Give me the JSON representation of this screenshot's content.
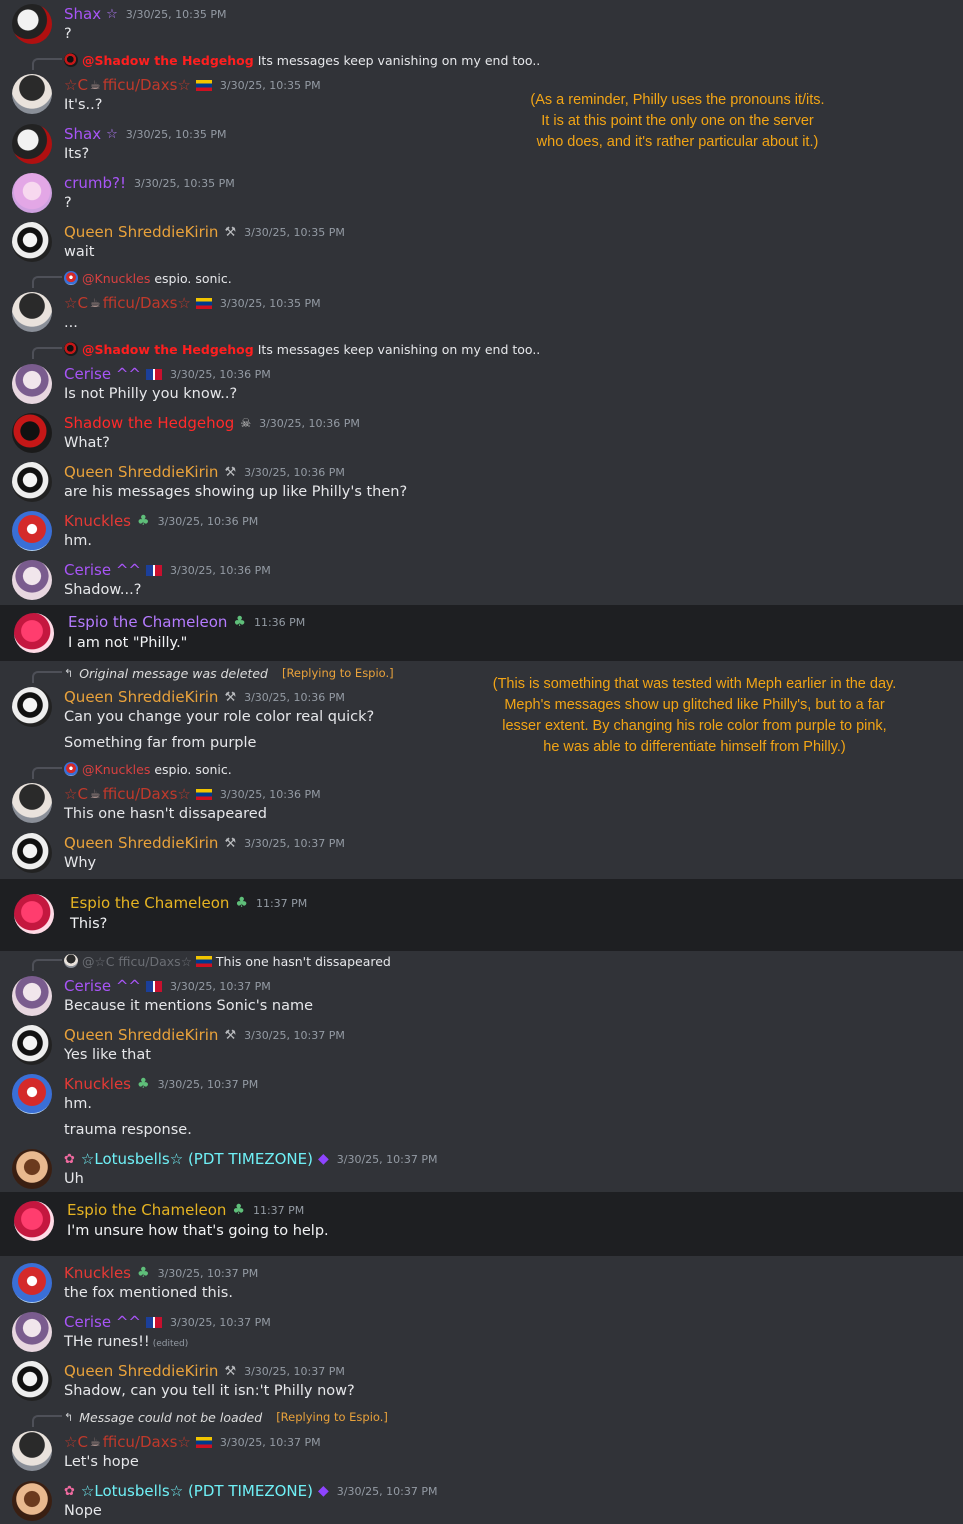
{
  "notes": {
    "pronouns": [
      "(As a reminder, Philly uses the pronouns it/its.",
      "It is at this point the only one on the server",
      "who does, and it's rather particular about it.)"
    ],
    "meph": [
      "(This is something that was tested with Meph earlier in the day.",
      "Meph's messages show up glitched like Philly's, but to a far",
      "lesser extent. By changing his role color from purple to pink,",
      "he was able to differentiate himself from Philly.)"
    ]
  },
  "names": {
    "shax": "Shax",
    "cofficu_pre": "☆C",
    "cofficu_post": "fficu/Daxs☆",
    "crumb": "crumb?!",
    "queen": "Queen ShreddieKirin",
    "cerise": "Cerise ^^",
    "shadow": "Shadow the Hedgehog",
    "knuckles": "Knuckles",
    "espio": "Espio the Chameleon",
    "lotus": "☆Lotusbells☆ (PDT TIMEZONE)"
  },
  "replies": {
    "r1_mention": "@Shadow the Hedgehog",
    "r1_text": "Its messages keep vanishing on my end too..",
    "r2_mention": "@Knuckles",
    "r2_text": "espio. sonic.",
    "r3_mention": "@Shadow the Hedgehog",
    "r3_text": "Its messages keep vanishing on my end too..",
    "r4_text": "Original message was deleted",
    "r4_tag": "[Replying to Espio.]",
    "r5_mention": "@Knuckles",
    "r5_text": "espio. sonic.",
    "r6_mention": "@☆C fficu/Daxs☆",
    "r6_text": "This one hasn't dissapeared",
    "r7_text": "Message could not be loaded",
    "r7_tag": "[Replying to Espio.]"
  },
  "messages": [
    {
      "time": "3/30/25, 10:35 PM",
      "text": "?"
    },
    {
      "time": "3/30/25, 10:35 PM",
      "text": "It's..?"
    },
    {
      "time": "3/30/25, 10:35 PM",
      "text": "Its?"
    },
    {
      "time": "3/30/25, 10:35 PM",
      "text": "?"
    },
    {
      "time": "3/30/25, 10:35 PM",
      "text": "wait"
    },
    {
      "time": "3/30/25, 10:35 PM",
      "text": "..."
    },
    {
      "time": "3/30/25, 10:36 PM",
      "text": "Is not Philly you know..?"
    },
    {
      "time": "3/30/25, 10:36 PM",
      "text": "What?"
    },
    {
      "time": "3/30/25, 10:36 PM",
      "text": "are his messages showing up like Philly's then?"
    },
    {
      "time": "3/30/25, 10:36 PM",
      "text": "hm."
    },
    {
      "time": "3/30/25, 10:36 PM",
      "text": "Shadow...?"
    },
    {
      "time": "11:36 PM",
      "text": "I am not \"Philly.\""
    },
    {
      "time": "3/30/25, 10:36 PM",
      "text": "Can you change your role color real quick?",
      "text2": "Something far from purple"
    },
    {
      "time": "3/30/25, 10:36 PM",
      "text": "This one hasn't dissapeared"
    },
    {
      "time": "3/30/25, 10:37 PM",
      "text": "Why"
    },
    {
      "time": "11:37 PM",
      "text": "This?"
    },
    {
      "time": "3/30/25, 10:37 PM",
      "text": "Because it mentions Sonic's name"
    },
    {
      "time": "3/30/25, 10:37 PM",
      "text": "Yes like that"
    },
    {
      "time": "3/30/25, 10:37 PM",
      "text": "hm.",
      "text2": "trauma response."
    },
    {
      "time": "3/30/25, 10:37 PM",
      "text": "Uh"
    },
    {
      "time": "11:37 PM",
      "text": "I'm unsure how that's going to help."
    },
    {
      "time": "3/30/25, 10:37 PM",
      "text": "the fox mentioned this."
    },
    {
      "time": "3/30/25, 10:37 PM",
      "text": "THe runes!!",
      "edited": "(edited)"
    },
    {
      "time": "3/30/25, 10:37 PM",
      "text": "Shadow, can you tell it isn:'t Philly now?"
    },
    {
      "time": "3/30/25, 10:37 PM",
      "text": "Let's hope"
    },
    {
      "time": "3/30/25, 10:37 PM",
      "text": "Nope"
    }
  ],
  "colors": {
    "background": "#313338",
    "highlight_background": "#1e1f22",
    "note": "#f2a516",
    "purple_role": "#a855f7",
    "orange_role": "#e9a23b",
    "red_role": "#e53935"
  }
}
